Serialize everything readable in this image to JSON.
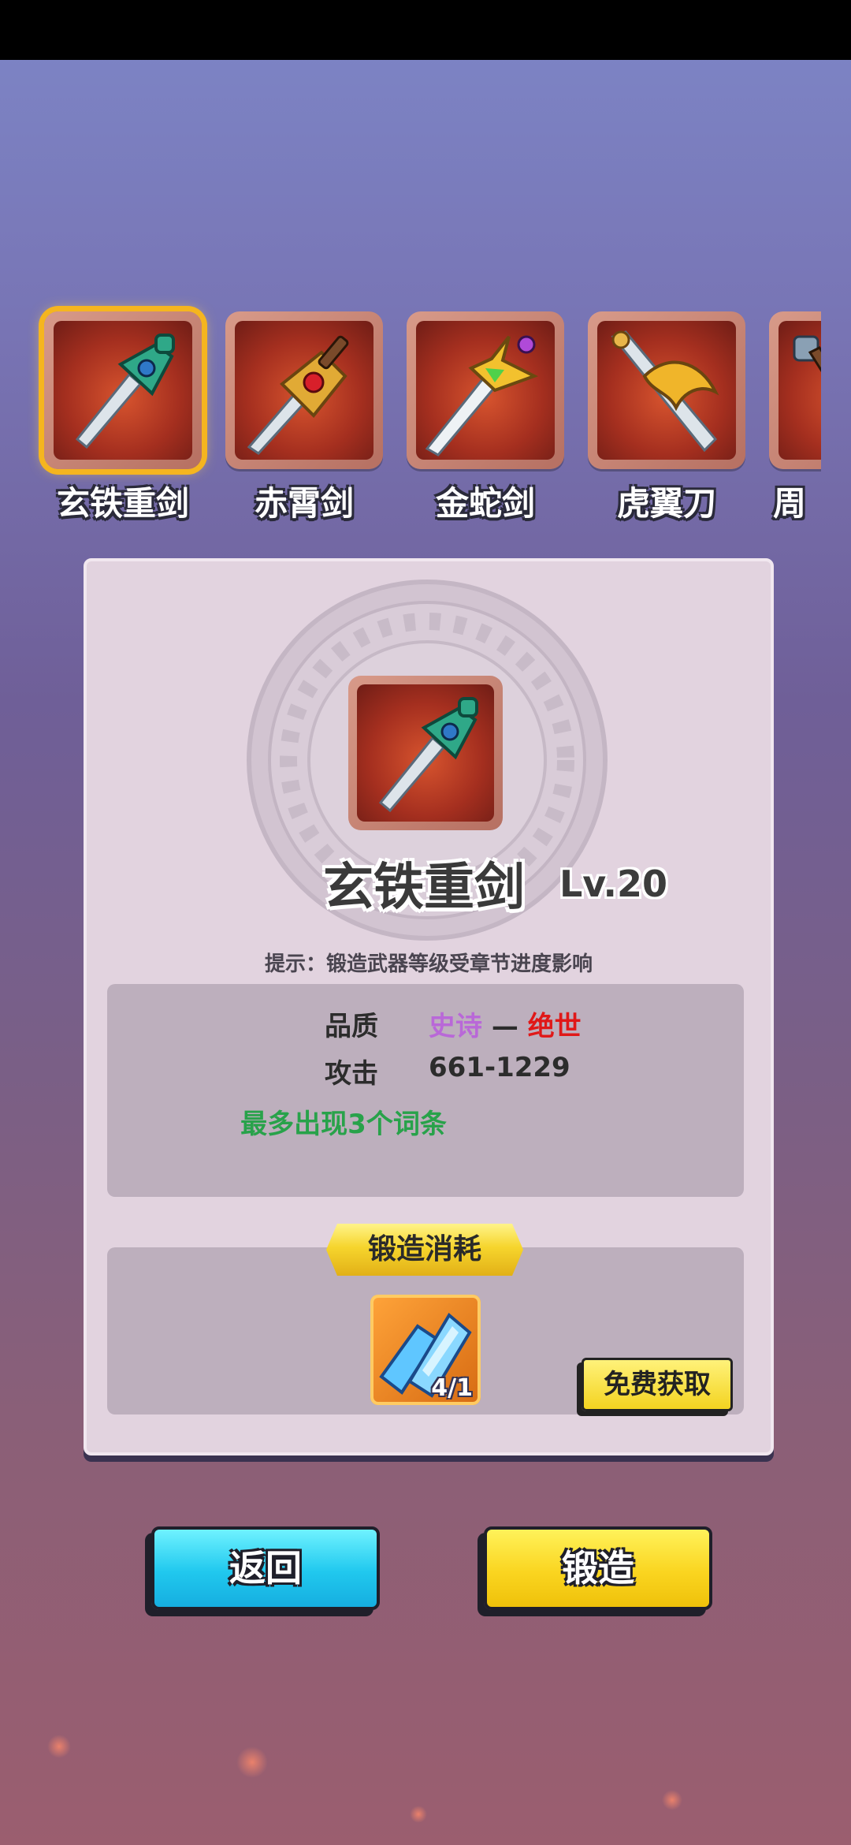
{
  "weapons": [
    {
      "name": "玄铁重剑",
      "selected": true,
      "icon": "heavy-sword-icon"
    },
    {
      "name": "赤霄剑",
      "selected": false,
      "icon": "red-gem-sword-icon"
    },
    {
      "name": "金蛇剑",
      "selected": false,
      "icon": "golden-snake-sword-icon"
    },
    {
      "name": "虎翼刀",
      "selected": false,
      "icon": "tiger-wing-blade-icon"
    },
    {
      "name": "周",
      "selected": false,
      "icon": "partial-weapon-icon"
    }
  ],
  "detail": {
    "name": "玄铁重剑",
    "level": "Lv.20",
    "hint": "提示：锻造武器等级受章节进度影响",
    "quality_label": "品质",
    "quality_low": "史诗",
    "quality_dash": "—",
    "quality_high": "绝世",
    "attack_label": "攻击",
    "attack_value": "661-1229",
    "note": "最多出现3个词条"
  },
  "cost": {
    "title": "锻造消耗",
    "material_icon": "blue-crystal-icon",
    "material_count": "4/1",
    "free_button": "免费获取"
  },
  "buttons": {
    "back": "返回",
    "forge": "锻造"
  },
  "colors": {
    "epic": "#b968d8",
    "legendary": "#e01818",
    "note": "#28a24a",
    "accent": "#f5b51f",
    "back": "#20c8ee",
    "forge": "#fad520"
  }
}
